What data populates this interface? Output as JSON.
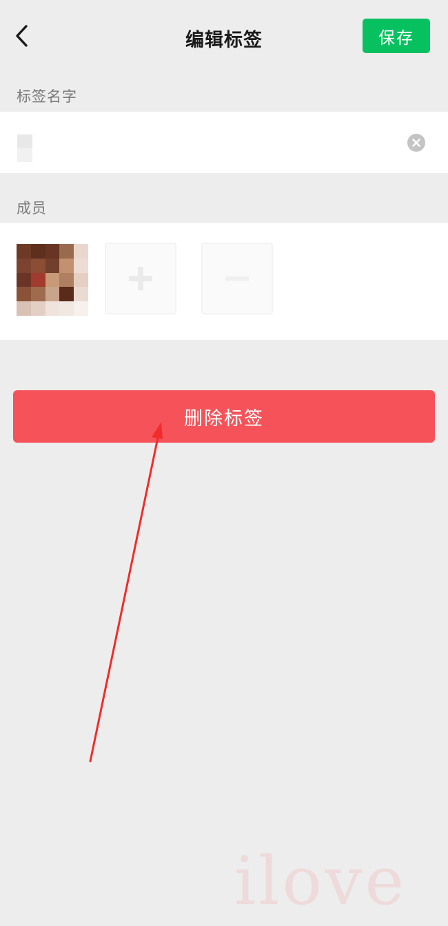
{
  "header": {
    "title": "编辑标签",
    "save_label": "保存",
    "back_icon": "chevron-left-icon"
  },
  "tag_name": {
    "section_label": "标签名字",
    "value": "",
    "clear_icon": "clear-circle-icon"
  },
  "members": {
    "section_label": "成员",
    "add_icon": "plus-icon",
    "remove_icon": "minus-icon"
  },
  "delete_label": "删除标签",
  "watermark": "ilove",
  "colors": {
    "accent_green": "#07c160",
    "danger_red": "#f55359",
    "background": "#ededed",
    "annotation_arrow": "#f22b2b"
  }
}
